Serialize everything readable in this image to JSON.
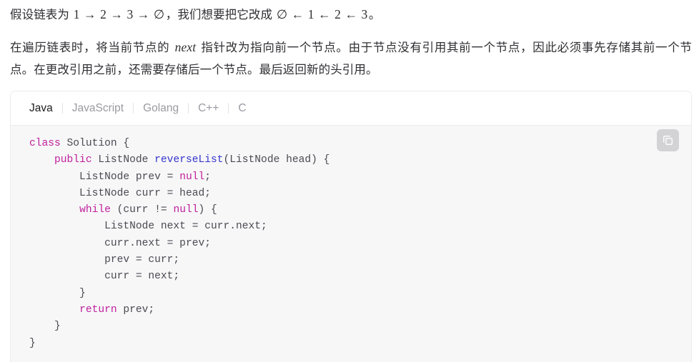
{
  "prose": {
    "paragraph1": {
      "segment_a": "假设链表为 ",
      "math_a": "1 → 2 → 3 → ∅",
      "segment_b": "，我们想要把它改成 ",
      "math_b": "∅ ← 1 ← 2 ← 3",
      "segment_c": "。"
    },
    "paragraph2": {
      "segment_a": "在遍历链表时，将当前节点的 ",
      "math_a": "next",
      "segment_b": " 指针改为指向前一个节点。由于节点没有引用其前一个节点，因此必须事先存储其前一个节点。在更改引用之前，还需要存储后一个节点。最后返回新的头引用。"
    }
  },
  "code_card": {
    "tabs": [
      {
        "label": "Java",
        "active": true
      },
      {
        "label": "JavaScript",
        "active": false
      },
      {
        "label": "Golang",
        "active": false
      },
      {
        "label": "C++",
        "active": false
      },
      {
        "label": "C",
        "active": false
      }
    ],
    "copy_button": {
      "icon": "copy-icon",
      "label": "复制代码"
    },
    "language": "Java",
    "code_lines": [
      [
        {
          "t": "class ",
          "c": "kw"
        },
        {
          "t": "Solution {",
          "c": "pl"
        }
      ],
      [
        {
          "t": "    ",
          "c": "pl"
        },
        {
          "t": "public ",
          "c": "kw"
        },
        {
          "t": "ListNode ",
          "c": "pl"
        },
        {
          "t": "reverseList",
          "c": "fn"
        },
        {
          "t": "(ListNode head) {",
          "c": "pl"
        }
      ],
      [
        {
          "t": "        ListNode prev = ",
          "c": "pl"
        },
        {
          "t": "null",
          "c": "kw"
        },
        {
          "t": ";",
          "c": "pl"
        }
      ],
      [
        {
          "t": "        ListNode curr = head;",
          "c": "pl"
        }
      ],
      [
        {
          "t": "        ",
          "c": "pl"
        },
        {
          "t": "while ",
          "c": "kw"
        },
        {
          "t": "(curr != ",
          "c": "pl"
        },
        {
          "t": "null",
          "c": "kw"
        },
        {
          "t": ") {",
          "c": "pl"
        }
      ],
      [
        {
          "t": "            ListNode next = curr.next;",
          "c": "pl"
        }
      ],
      [
        {
          "t": "            curr.next = prev;",
          "c": "pl"
        }
      ],
      [
        {
          "t": "            prev = curr;",
          "c": "pl"
        }
      ],
      [
        {
          "t": "            curr = next;",
          "c": "pl"
        }
      ],
      [
        {
          "t": "        }",
          "c": "pl"
        }
      ],
      [
        {
          "t": "        ",
          "c": "pl"
        },
        {
          "t": "return ",
          "c": "kw"
        },
        {
          "t": "prev;",
          "c": "pl"
        }
      ],
      [
        {
          "t": "    }",
          "c": "pl"
        }
      ],
      [
        {
          "t": "}",
          "c": "pl"
        }
      ]
    ],
    "code_plain": "class Solution {\n    public ListNode reverseList(ListNode head) {\n        ListNode prev = null;\n        ListNode curr = head;\n        while (curr != null) {\n            ListNode next = curr.next;\n            curr.next = prev;\n            prev = curr;\n            curr = next;\n        }\n        return prev;\n    }\n}"
  },
  "colors": {
    "page_background": "#ffffff",
    "text": "#2f2f33",
    "code_background": "#f7f7f8",
    "tabbar_background": "#ffffff",
    "card_border": "#ececef",
    "tab_active": "#1c1c1e",
    "tab_inactive": "#9a9aa2",
    "keyword": "#c0209c",
    "function": "#3535cc",
    "code_plain": "#4a4a52",
    "copy_button_background": "#d3d3d6"
  }
}
